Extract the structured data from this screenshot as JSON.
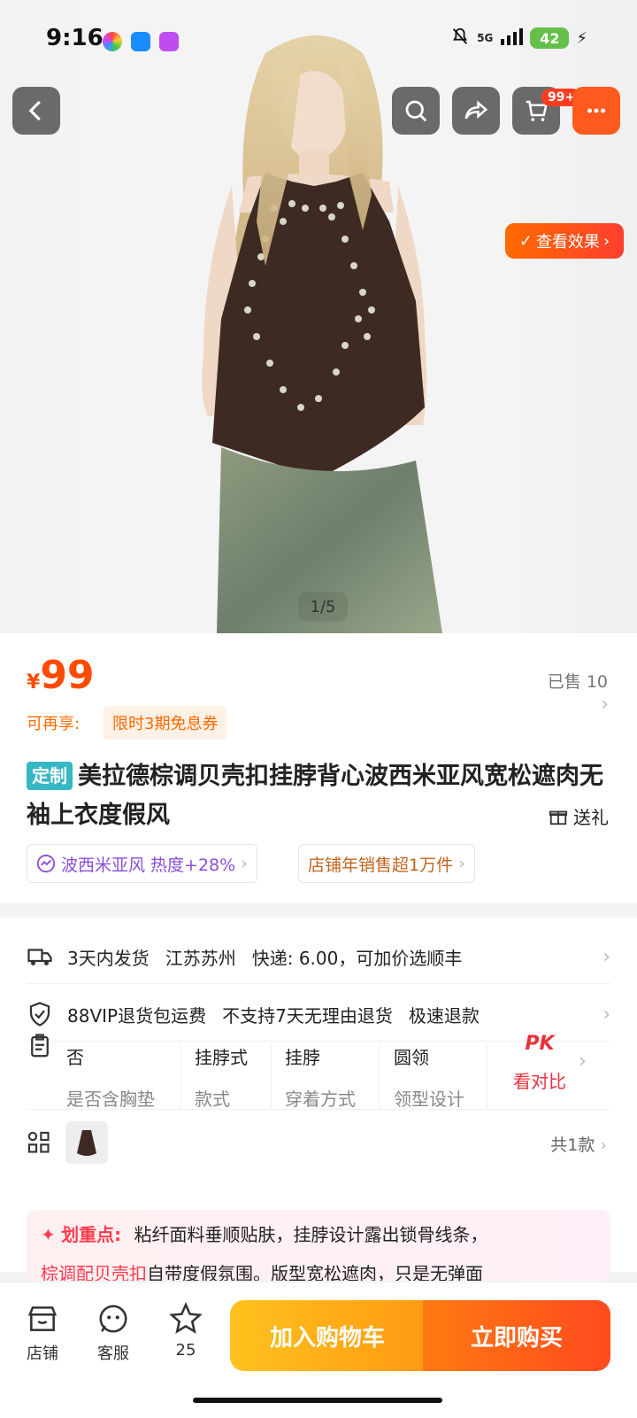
{
  "status_bar": {
    "time": "9:16",
    "network": "5G",
    "battery": "42"
  },
  "top_bar": {
    "cart_badge": "99+"
  },
  "hero": {
    "view_effect_label": "查看效果",
    "pager": "1/5"
  },
  "price": {
    "currency": "¥",
    "value": "99",
    "sold": "已售 10"
  },
  "promo": {
    "label": "可再享:",
    "chip": "限时3期免息券"
  },
  "product": {
    "tag": "定制",
    "title": "美拉德棕调贝壳扣挂脖背心波西米亚风宽松遮肉无袖上衣度假风",
    "gift_label": "送礼"
  },
  "chips": [
    {
      "text": "波西米亚风 热度+28%",
      "color": "#8a4fd8"
    },
    {
      "text": "店铺年销售超1万件",
      "color": "#c0641e"
    }
  ],
  "service": {
    "shipping": {
      "dispatch": "3天内发货",
      "location": "江苏苏州",
      "express": "快递: 6.00，可加价选顺丰"
    },
    "returns": {
      "vip": "88VIP退货包运费",
      "policy": "不支持7天无理由退货",
      "refund": "极速退款"
    }
  },
  "attributes": [
    {
      "value": "否",
      "key": "是否含胸垫"
    },
    {
      "value": "挂脖式",
      "key": "款式"
    },
    {
      "value": "挂脖",
      "key": "穿着方式"
    },
    {
      "value": "圆领",
      "key": "领型设计"
    }
  ],
  "compare": {
    "pk": "PK",
    "label": "看对比"
  },
  "variants": {
    "count": "共1款"
  },
  "highlight": {
    "label": "划重点:",
    "line1": "粘纤面料垂顺贴肤，挂脖设计露出锁骨线条，",
    "line2_red": "棕调配贝壳扣",
    "line2_rest": "自带度假氛围。版型宽松遮肉，只是无弹面"
  },
  "bottom_bar": {
    "shop": "店铺",
    "service": "客服",
    "favorites": "25",
    "add_to_cart": "加入购物车",
    "buy_now": "立即购买"
  },
  "colors": {
    "accent": "#ff4b00",
    "cart_grad": "#ffb21e",
    "buy_grad": "#ff5a1e"
  }
}
